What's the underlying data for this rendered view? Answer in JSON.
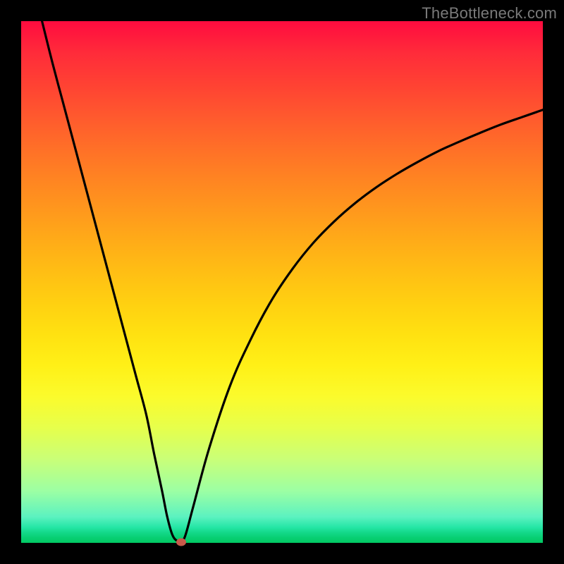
{
  "watermark": "TheBottleneck.com",
  "colors": {
    "frame": "#000000",
    "curve": "#000000",
    "marker": "#c85a4a",
    "gradient_top": "#ff0b3f",
    "gradient_bottom": "#02c963"
  },
  "chart_data": {
    "type": "line",
    "title": "",
    "xlabel": "",
    "ylabel": "",
    "xlim": [
      0,
      100
    ],
    "ylim": [
      0,
      100
    ],
    "grid": false,
    "series": [
      {
        "name": "curve",
        "x": [
          4,
          6,
          8,
          10,
          12,
          14,
          16,
          18,
          20,
          22,
          24,
          25.5,
          27,
          28,
          29,
          30,
          30.7,
          31.5,
          33,
          36,
          40,
          44,
          48,
          52,
          56,
          60,
          64,
          68,
          72,
          76,
          80,
          84,
          88,
          92,
          96,
          100
        ],
        "y": [
          100,
          92,
          84.5,
          77,
          69.5,
          62,
          54.5,
          47,
          39.5,
          32,
          24.5,
          17,
          10,
          5,
          1.5,
          0.3,
          0.2,
          1.5,
          7,
          18,
          30,
          39,
          46.5,
          52.5,
          57.5,
          61.6,
          65.1,
          68.1,
          70.7,
          73,
          75.1,
          76.9,
          78.6,
          80.2,
          81.6,
          83
        ]
      }
    ],
    "marker": {
      "x": 30.7,
      "y": 0.2
    }
  }
}
